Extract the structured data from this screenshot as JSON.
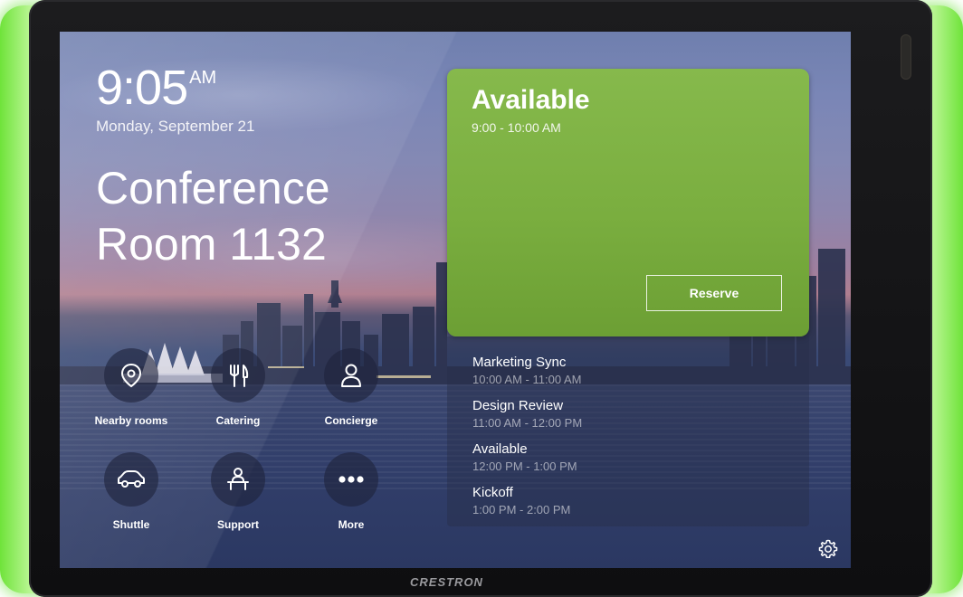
{
  "clock": {
    "time": "9:05",
    "ampm": "AM",
    "date": "Monday, September 21"
  },
  "room": {
    "name": "Conference Room 1132"
  },
  "tiles": [
    {
      "label": "Nearby rooms",
      "icon": "location-pin-icon"
    },
    {
      "label": "Catering",
      "icon": "fork-knife-icon"
    },
    {
      "label": "Concierge",
      "icon": "person-icon"
    },
    {
      "label": "Shuttle",
      "icon": "car-icon"
    },
    {
      "label": "Support",
      "icon": "support-desk-icon"
    },
    {
      "label": "More",
      "icon": "ellipsis-icon"
    }
  ],
  "status": {
    "title": "Available",
    "range": "9:00 - 10:00 AM",
    "reserve_label": "Reserve"
  },
  "schedule": [
    {
      "name": "Marketing Sync",
      "when": "10:00 AM - 11:00 AM"
    },
    {
      "name": "Design Review",
      "when": "11:00 AM - 12:00 PM"
    },
    {
      "name": "Available",
      "when": "12:00 PM - 1:00 PM"
    },
    {
      "name": "Kickoff",
      "when": "1:00 PM - 2:00 PM"
    }
  ],
  "brand": "CRESTRON",
  "colors": {
    "available_green": "#7aae3f",
    "glow": "#6fe33a",
    "bezel": "#111113"
  }
}
